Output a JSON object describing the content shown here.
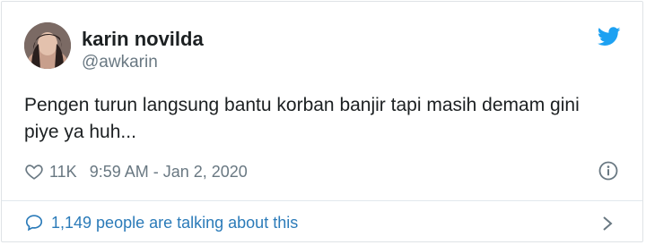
{
  "user": {
    "name": "karin novilda",
    "handle": "@awkarin"
  },
  "tweet": {
    "text": "Pengen turun langsung bantu korban banjir tapi masih demam gini piye ya huh..."
  },
  "meta": {
    "likes": "11K",
    "timestamp": "9:59 AM - Jan 2, 2020"
  },
  "footer": {
    "talking_label": "1,149 people are talking about this"
  },
  "icons": {
    "brand": "twitter-bird-icon",
    "like": "heart-icon",
    "info": "info-icon",
    "reply": "speech-bubble-icon",
    "more": "chevron-right-icon"
  },
  "colors": {
    "twitter_blue": "#1da1f2",
    "link_blue": "#2b7bb9",
    "secondary_text": "#697882",
    "primary_text": "#1c2022"
  }
}
